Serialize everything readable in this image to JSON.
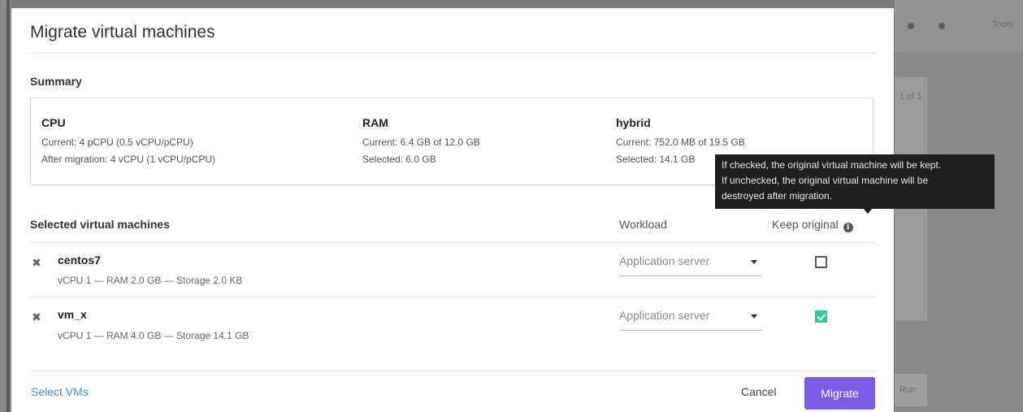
{
  "background": {
    "right_snippet_1": "1 of 1",
    "right_snippet_2": "Tools",
    "right_snippet_3": "Run"
  },
  "dialog": {
    "title": "Migrate virtual machines",
    "summary_label": "Summary",
    "summary": {
      "cpu": {
        "heading": "CPU",
        "line1": "Current: 4 pCPU (0.5 vCPU/pCPU)",
        "line2": "After migration: 4 vCPU (1 vCPU/pCPU)"
      },
      "ram": {
        "heading": "RAM",
        "line1": "Current: 6.4 GB of 12.0 GB",
        "line2": "Selected: 6.0 GB"
      },
      "storage": {
        "heading": "hybrid",
        "line1": "Current: 752.0 MB of 19.5 GB",
        "line2": "Selected: 14.1 GB"
      }
    },
    "table": {
      "selected_header": "Selected virtual machines",
      "workload_header": "Workload",
      "keep_original_header": "Keep original",
      "rows": [
        {
          "remove_glyph": "✖",
          "name": "centos7",
          "spec": "vCPU 1 — RAM 2.0 GB — Storage 2.0 KB",
          "workload": "Application server",
          "keep_original": false
        },
        {
          "remove_glyph": "✖",
          "name": "vm_x",
          "spec": "vCPU 1 — RAM 4.0 GB — Storage 14.1 GB",
          "workload": "Application server",
          "keep_original": true
        }
      ]
    },
    "footer": {
      "select_vms": "Select VMs",
      "cancel": "Cancel",
      "migrate": "Migrate"
    },
    "tooltip": {
      "line1": "If checked, the original virtual machine will be kept.",
      "line2": "If unchecked, the original virtual machine will be",
      "line3": "destroyed after migration."
    }
  },
  "colors": {
    "accent": "#7c5ce6",
    "link": "#3d8fd8",
    "checkbox_checked": "#2ecc9a",
    "tooltip_bg": "#1f1f1f"
  },
  "icons": {
    "remove": "close-icon",
    "info": "info-icon",
    "dropdown": "caret-down-icon",
    "checkmark": "check-icon"
  }
}
